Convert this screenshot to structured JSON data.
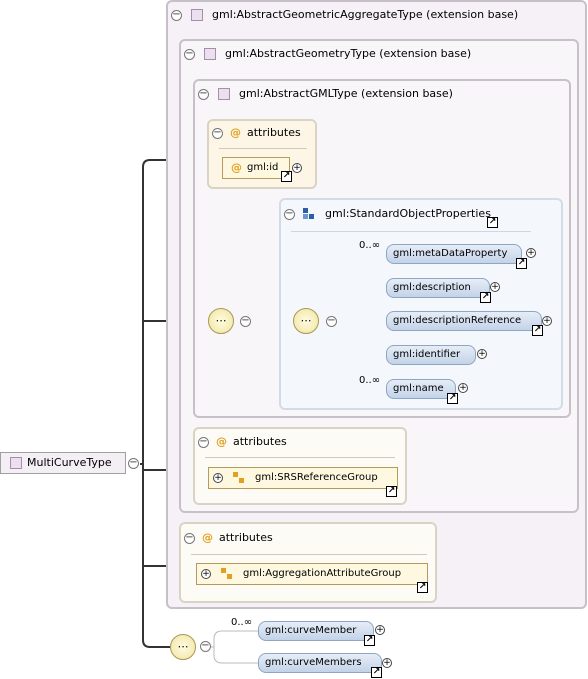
{
  "diagram": {
    "root": {
      "label": "MultiCurveType"
    },
    "extensions": {
      "aggregate": "gml:AbstractGeometricAggregateType (extension base)",
      "geometry": "gml:AbstractGeometryType (extension base)",
      "gml": "gml:AbstractGMLType (extension base)"
    },
    "attributes_label": "attributes",
    "gml_id": "gml:id",
    "standard_object_properties": {
      "label": "gml:StandardObjectProperties",
      "elements": [
        {
          "label": "gml:metaDataProperty",
          "cardinality": "0..∞"
        },
        {
          "label": "gml:description",
          "cardinality": ""
        },
        {
          "label": "gml:descriptionReference",
          "cardinality": ""
        },
        {
          "label": "gml:identifier",
          "cardinality": ""
        },
        {
          "label": "gml:name",
          "cardinality": "0..∞"
        }
      ]
    },
    "srs_group": "gml:SRSReferenceGroup",
    "aggregation_group": "gml:AggregationAttributeGroup",
    "curve_elements": [
      {
        "label": "gml:curveMember",
        "cardinality": "0..∞"
      },
      {
        "label": "gml:curveMembers",
        "cardinality": ""
      }
    ],
    "colors": {
      "extension_fill": "#f5f1f6",
      "attribute_fill": "#fdf6e6",
      "element_fill": "#c3d3e8",
      "line": "#333333"
    }
  }
}
